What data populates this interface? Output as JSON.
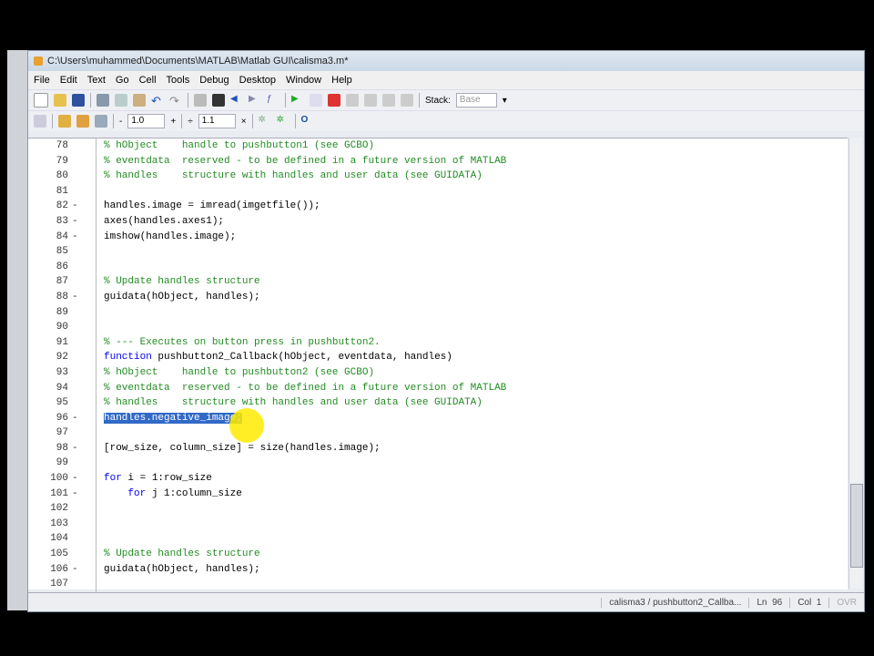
{
  "window": {
    "title": "C:\\Users\\muhammed\\Documents\\MATLAB\\Matlab GUI\\calisma3.m*"
  },
  "menu": [
    "File",
    "Edit",
    "Text",
    "Go",
    "Cell",
    "Tools",
    "Debug",
    "Desktop",
    "Window",
    "Help"
  ],
  "toolbar": {
    "stack_label": "Stack:",
    "stack_value": "Base",
    "minus": "-",
    "cell_value1": "1.0",
    "plus": "+",
    "divide": "÷",
    "cell_value2": "1.1",
    "times": "×"
  },
  "lines": [
    {
      "n": "78",
      "d": "",
      "t": "% hObject    handle to pushbutton1 (see GCBO)",
      "k": "cm"
    },
    {
      "n": "79",
      "d": "",
      "t": "% eventdata  reserved - to be defined in a future version of MATLAB",
      "k": "cm"
    },
    {
      "n": "80",
      "d": "",
      "t": "% handles    structure with handles and user data (see GUIDATA)",
      "k": "cm"
    },
    {
      "n": "81",
      "d": "",
      "t": "",
      "k": ""
    },
    {
      "n": "82",
      "d": "-",
      "t": "handles.image = imread(imgetfile());",
      "k": ""
    },
    {
      "n": "83",
      "d": "-",
      "t": "axes(handles.axes1);",
      "k": ""
    },
    {
      "n": "84",
      "d": "-",
      "t": "imshow(handles.image);",
      "k": ""
    },
    {
      "n": "85",
      "d": "",
      "t": "",
      "k": ""
    },
    {
      "n": "86",
      "d": "",
      "t": "",
      "k": ""
    },
    {
      "n": "87",
      "d": "",
      "t": "% Update handles structure",
      "k": "cm"
    },
    {
      "n": "88",
      "d": "-",
      "t": "guidata(hObject, handles);",
      "k": ""
    },
    {
      "n": "89",
      "d": "",
      "t": "",
      "k": ""
    },
    {
      "n": "90",
      "d": "",
      "t": "",
      "k": ""
    },
    {
      "n": "91",
      "d": "",
      "t": "% --- Executes on button press in pushbutton2.",
      "k": "cm"
    },
    {
      "n": "92",
      "d": "",
      "t": "pushbutton2_Callback(hObject, eventdata, handles)",
      "k": "fn",
      "kw": "function "
    },
    {
      "n": "93",
      "d": "",
      "t": "% hObject    handle to pushbutton2 (see GCBO)",
      "k": "cm"
    },
    {
      "n": "94",
      "d": "",
      "t": "% eventdata  reserved - to be defined in a future version of MATLAB",
      "k": "cm"
    },
    {
      "n": "95",
      "d": "",
      "t": "% handles    structure with handles and user data (see GUIDATA)",
      "k": "cm"
    },
    {
      "n": "96",
      "d": "-",
      "t": "handles.negative_image;",
      "k": "sel"
    },
    {
      "n": "97",
      "d": "",
      "t": "",
      "k": ""
    },
    {
      "n": "98",
      "d": "-",
      "t": "[row_size, column_size] = size(handles.image);",
      "k": ""
    },
    {
      "n": "99",
      "d": "",
      "t": "",
      "k": ""
    },
    {
      "n": "100",
      "d": "-",
      "t": " i = 1:row_size",
      "k": "fn",
      "kw": "for"
    },
    {
      "n": "101",
      "d": "-",
      "t": " j 1:column_size",
      "k": "fn",
      "kw": "    for"
    },
    {
      "n": "102",
      "d": "",
      "t": "",
      "k": ""
    },
    {
      "n": "103",
      "d": "",
      "t": "",
      "k": ""
    },
    {
      "n": "104",
      "d": "",
      "t": "",
      "k": ""
    },
    {
      "n": "105",
      "d": "",
      "t": "% Update handles structure",
      "k": "cm"
    },
    {
      "n": "106",
      "d": "-",
      "t": "guidata(hObject, handles);",
      "k": ""
    },
    {
      "n": "107",
      "d": "",
      "t": "",
      "k": ""
    }
  ],
  "status": {
    "location": "calisma3 / pushbutton2_Callba...",
    "ln_label": "Ln",
    "ln": "96",
    "col_label": "Col",
    "col": "1",
    "ovr": "OVR"
  }
}
